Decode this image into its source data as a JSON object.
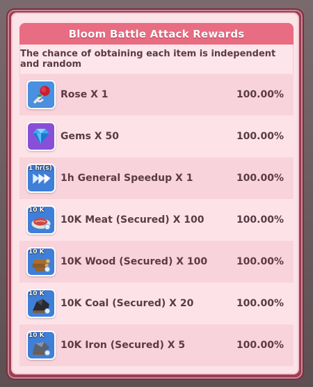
{
  "dialog": {
    "title": "Bloom Battle Attack Rewards",
    "subtitle": "The chance of obtaining each item is independent and random"
  },
  "rewards": [
    {
      "icon": "rose-icon",
      "tag": "",
      "name": "Rose X 1",
      "chance": "100.00%"
    },
    {
      "icon": "gems-icon",
      "tag": "",
      "name": "Gems X 50",
      "chance": "100.00%"
    },
    {
      "icon": "speedup-icon",
      "tag": "1 hr(s)",
      "name": "1h General Speedup X 1",
      "chance": "100.00%"
    },
    {
      "icon": "meat-icon",
      "tag": "10 K",
      "name": "10K Meat (Secured) X 100",
      "chance": "100.00%"
    },
    {
      "icon": "wood-icon",
      "tag": "10 K",
      "name": "10K Wood (Secured) X 100",
      "chance": "100.00%"
    },
    {
      "icon": "coal-icon",
      "tag": "10 K",
      "name": "10K Coal (Secured) X 20",
      "chance": "100.00%"
    },
    {
      "icon": "iron-icon",
      "tag": "10 K",
      "name": "10K Iron (Secured) X 5",
      "chance": "100.00%"
    }
  ],
  "colors": {
    "title_bar": "#e86c82",
    "frame": "#9c3f52",
    "row_odd": "#f9d3db",
    "row_even": "#fde3e8",
    "text": "#5b3a44"
  }
}
